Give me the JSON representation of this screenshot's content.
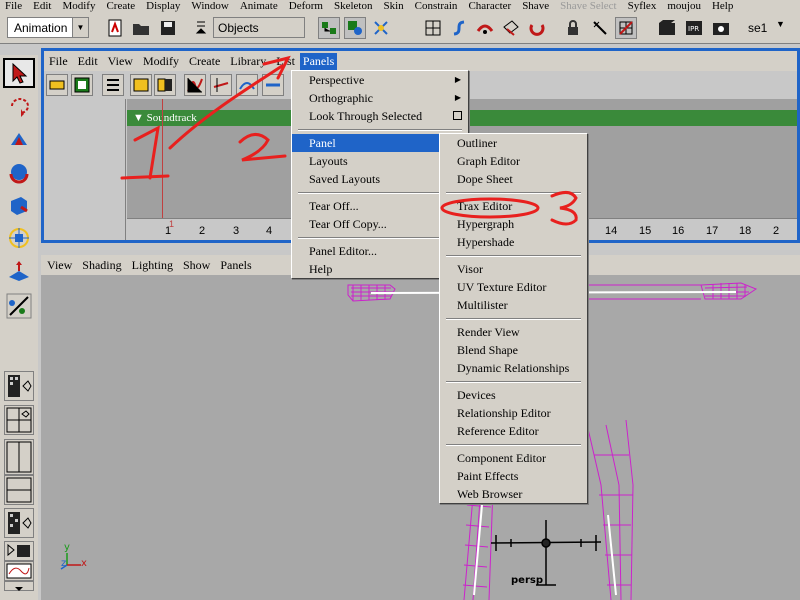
{
  "main_menu": [
    "File",
    "Edit",
    "Modify",
    "Create",
    "Display",
    "Window",
    "Animate",
    "Deform",
    "Skeleton",
    "Skin",
    "Constrain",
    "Character",
    "Shave",
    "Shave Select",
    "Syflex",
    "moujou",
    "Help"
  ],
  "main_menu_disabled": [
    "Shave Select"
  ],
  "shelf": {
    "mode": "Animation",
    "objects_field": "Objects",
    "sel_field": "se1"
  },
  "panel_menu": {
    "items": [
      "File",
      "Edit",
      "View",
      "Modify",
      "Create",
      "Library",
      "List",
      "Panels"
    ],
    "active": "Panels"
  },
  "trax": {
    "soundtrack_label": "Soundtrack",
    "ticks": [
      "1",
      "2",
      "3",
      "4",
      "14",
      "15",
      "16",
      "17",
      "18",
      "2"
    ],
    "current_frame": "1"
  },
  "viewport_menu": [
    "View",
    "Shading",
    "Lighting",
    "Show",
    "Panels"
  ],
  "viewport": {
    "camera_label": "persp",
    "axis_y": "y",
    "axis_z": "z",
    "axis_x": "x"
  },
  "panels_menu": {
    "groups": [
      [
        {
          "label": "Perspective",
          "submenu": true
        },
        {
          "label": "Orthographic",
          "submenu": true
        },
        {
          "label": "Look Through Selected",
          "tearoff": true
        }
      ],
      [
        {
          "label": "Panel",
          "submenu": true,
          "highlighted": true
        },
        {
          "label": "Layouts",
          "submenu": true
        },
        {
          "label": "Saved Layouts",
          "submenu": true
        }
      ],
      [
        {
          "label": "Tear Off..."
        },
        {
          "label": "Tear Off Copy..."
        }
      ],
      [
        {
          "label": "Panel Editor..."
        },
        {
          "label": "Help",
          "submenu": true
        }
      ]
    ]
  },
  "panel_submenu": {
    "groups": [
      [
        "Outliner",
        "Graph Editor",
        "Dope Sheet"
      ],
      [
        "Trax Editor",
        "Hypergraph",
        "Hypershade"
      ],
      [
        "Visor",
        "UV Texture Editor",
        "Multilister"
      ],
      [
        "Render View",
        "Blend Shape",
        "Dynamic Relationships"
      ],
      [
        "Devices",
        "Relationship Editor",
        "Reference Editor"
      ],
      [
        "Component Editor",
        "Paint Effects",
        "Web Browser"
      ]
    ]
  },
  "annotations": {
    "step1": "1",
    "step2": "2",
    "step3": "3",
    "color": "#e8201e"
  },
  "colors": {
    "panel_highlight": "#1f64c8",
    "soundtrack": "#3a8a3a",
    "skeleton": "#cc22cc"
  }
}
